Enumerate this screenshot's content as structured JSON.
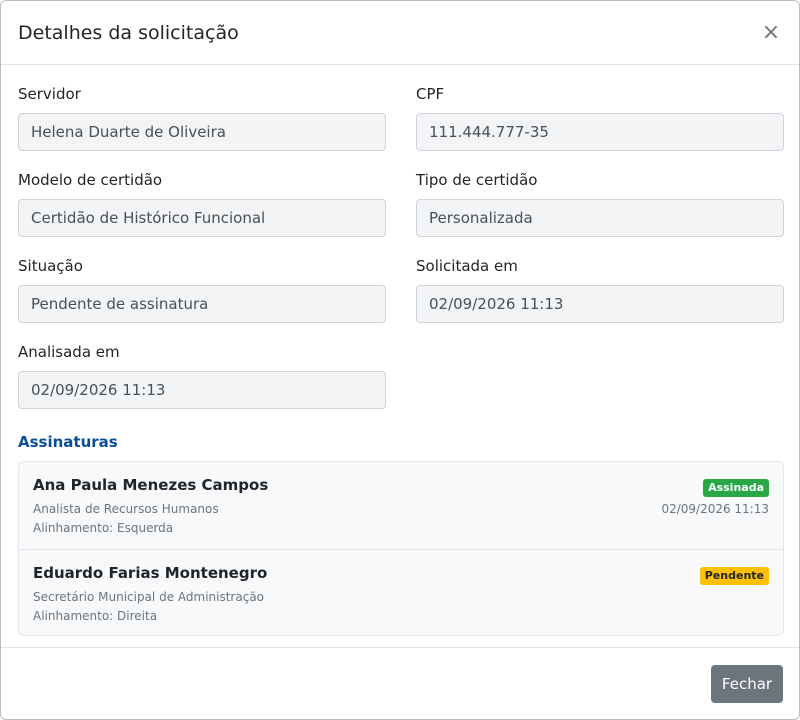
{
  "modal": {
    "title": "Detalhes da solicitação",
    "close_icon": "×"
  },
  "fields": {
    "servidor": {
      "label": "Servidor",
      "value": "Helena Duarte de Oliveira"
    },
    "cpf": {
      "label": "CPF",
      "value": "111.444.777-35"
    },
    "modelo": {
      "label": "Modelo de certidão",
      "value": "Certidão de Histórico Funcional"
    },
    "tipo": {
      "label": "Tipo de certidão",
      "value": "Personalizada"
    },
    "situacao": {
      "label": "Situação",
      "value": "Pendente de assinatura"
    },
    "solicitada": {
      "label": "Solicitada em",
      "value": "02/09/2026 11:13"
    },
    "analisada": {
      "label": "Analisada em",
      "value": "02/09/2026 11:13"
    }
  },
  "signatures": {
    "title": "Assinaturas",
    "items": [
      {
        "name": "Ana Paula Menezes Campos",
        "role": "Analista de Recursos Humanos",
        "alignment": "Alinhamento: Esquerda",
        "status": "Assinada",
        "status_color": "#28a745",
        "date": "02/09/2026 11:13"
      },
      {
        "name": "Eduardo Farias Montenegro",
        "role": "Secretário Municipal de Administração",
        "alignment": "Alinhamento: Direita",
        "status": "Pendente",
        "status_color": "#ffc107"
      }
    ]
  },
  "footer": {
    "close_label": "Fechar"
  }
}
